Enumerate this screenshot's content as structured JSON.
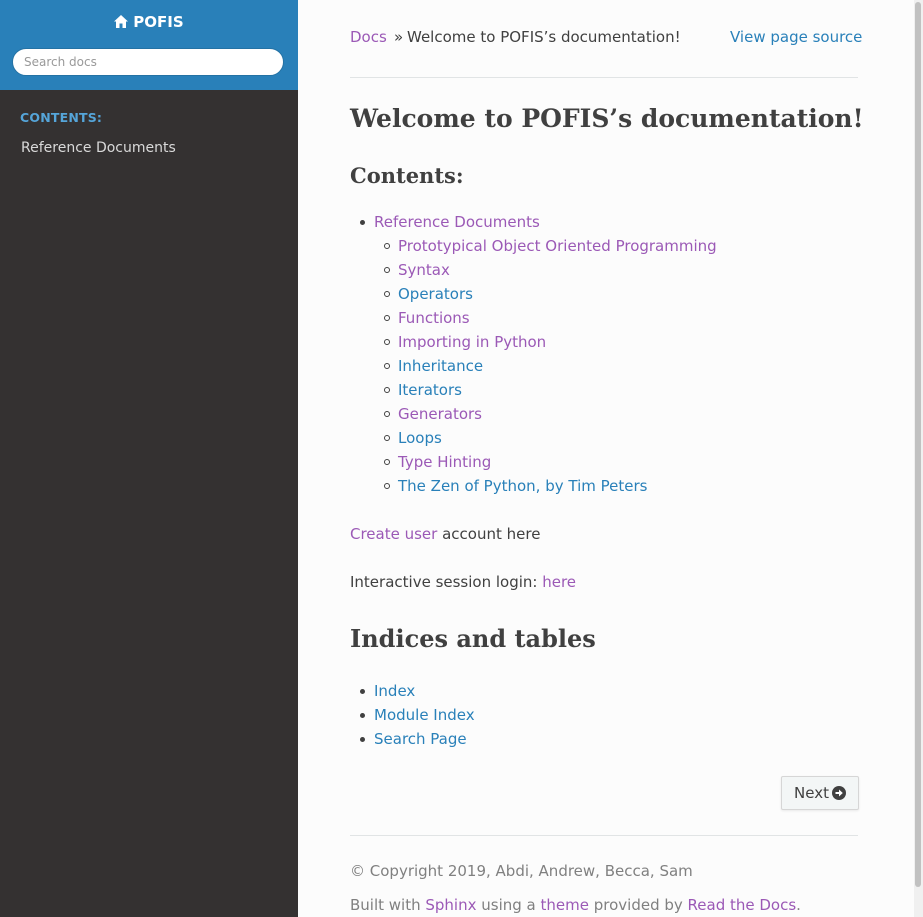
{
  "sidebar": {
    "brand": "POFIS",
    "search_placeholder": "Search docs",
    "caption": "CONTENTS:",
    "items": [
      {
        "label": "Reference Documents"
      }
    ]
  },
  "breadcrumb": {
    "docs": "Docs",
    "separator": "»",
    "current": "Welcome to POFIS’s documentation!",
    "view_source": "View page source"
  },
  "page": {
    "title": "Welcome to POFIS’s documentation!",
    "contents_heading": "Contents:",
    "toc_top": "Reference Documents",
    "toc_children": [
      "Prototypical Object Oriented Programming",
      "Syntax",
      "Operators",
      "Functions",
      "Importing in Python",
      "Inheritance",
      "Iterators",
      "Generators",
      "Loops",
      "Type Hinting",
      "The Zen of Python, by Tim Peters"
    ],
    "create_user_link": "Create user",
    "create_user_text": " account here",
    "login_text": "Interactive session login: ",
    "login_link": "here",
    "indices_heading": "Indices and tables",
    "indices": [
      "Index",
      "Module Index",
      "Search Page"
    ],
    "next_label": "Next"
  },
  "footer": {
    "copyright": "© Copyright 2019, Abdi, Andrew, Becca, Sam",
    "built_prefix": "Built with ",
    "sphinx": "Sphinx",
    "using": " using a ",
    "theme": "theme",
    "provided": " provided by ",
    "rtd": "Read the Docs",
    "period": "."
  },
  "colors": {
    "sidebar_top": "#2980b9",
    "sidebar_bg": "#343131",
    "link": "#2980b9",
    "visited_link": "#9b59b6",
    "caption": "#55a5d9"
  }
}
